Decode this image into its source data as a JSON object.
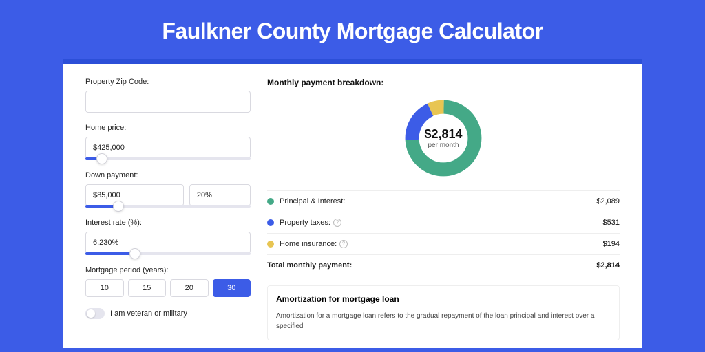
{
  "title": "Faulkner County Mortgage Calculator",
  "form": {
    "zip_label": "Property Zip Code:",
    "zip_value": "",
    "price_label": "Home price:",
    "price_value": "$425,000",
    "down_label": "Down payment:",
    "down_value": "$85,000",
    "down_pct": "20%",
    "rate_label": "Interest rate (%):",
    "rate_value": "6.230%",
    "period_label": "Mortgage period (years):",
    "periods": [
      "10",
      "15",
      "20",
      "30"
    ],
    "period_active": "30",
    "vet_label": "I am veteran or military"
  },
  "breakdown": {
    "heading": "Monthly payment breakdown:",
    "center_amount": "$2,814",
    "center_sub": "per month",
    "principal_label": "Principal & Interest:",
    "principal_val": "$2,089",
    "tax_label": "Property taxes:",
    "tax_val": "$531",
    "ins_label": "Home insurance:",
    "ins_val": "$194",
    "total_label": "Total monthly payment:",
    "total_val": "$2,814"
  },
  "amort": {
    "heading": "Amortization for mortgage loan",
    "body": "Amortization for a mortgage loan refers to the gradual repayment of the loan principal and interest over a specified"
  },
  "chart_data": {
    "type": "pie",
    "title": "Monthly payment breakdown",
    "series": [
      {
        "name": "Principal & Interest",
        "value": 2089,
        "color": "#44a987"
      },
      {
        "name": "Property taxes",
        "value": 531,
        "color": "#3C5CE7"
      },
      {
        "name": "Home insurance",
        "value": 194,
        "color": "#e8c552"
      }
    ],
    "total": 2814
  }
}
